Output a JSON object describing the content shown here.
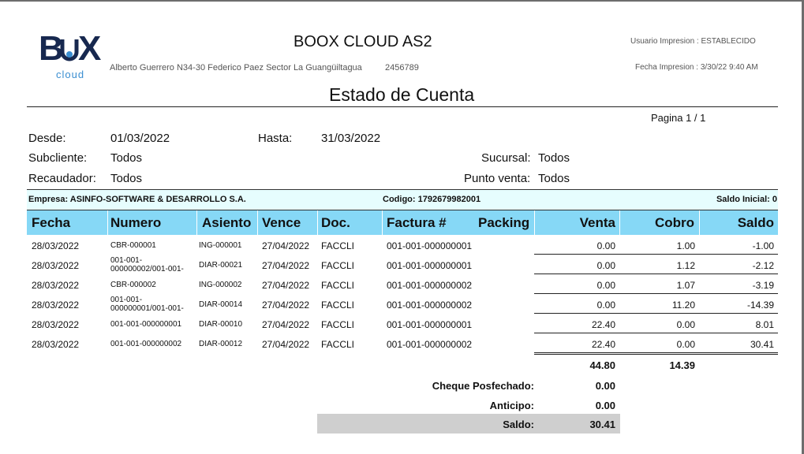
{
  "header": {
    "logo_text": "B  X",
    "logo_sub": "cloud",
    "company": "BOOX CLOUD AS2",
    "address": "Alberto Guerrero N34-30 Federico Paez Sector La Guangüiltagua",
    "phone": "2456789",
    "user_print": "Usuario Impresion : ESTABLECIDO",
    "date_print": "Fecha Impresion : 3/30/22 9:40 AM",
    "title": "Estado de Cuenta",
    "page": "Pagina 1 / 1"
  },
  "filters": {
    "desde_label": "Desde:",
    "desde_value": "01/03/2022",
    "hasta_label": "Hasta:",
    "hasta_value": "31/03/2022",
    "subcliente_label": "Subcliente:",
    "subcliente_value": "Todos",
    "sucursal_label": "Sucursal:",
    "sucursal_value": "Todos",
    "recaudador_label": "Recaudador:",
    "recaudador_value": "Todos",
    "punto_label": "Punto venta:",
    "punto_value": "Todos"
  },
  "info": {
    "empresa": "Empresa:  ASINFO-SOFTWARE & DESARROLLO S.A.",
    "codigo": "Codigo:  1792679982001",
    "saldo_inicial": "Saldo Inicial:  0"
  },
  "columns": [
    "Fecha",
    "Numero",
    "Asiento",
    "Vence",
    "Doc.",
    "Factura #",
    "Packing",
    "Venta",
    "Cobro",
    "Saldo"
  ],
  "rows": [
    {
      "fecha": "28/03/2022",
      "numero": "CBR-000001",
      "asiento": "ING-000001",
      "vence": "27/04/2022",
      "doc": "FACCLI",
      "factura": "001-001-000000001",
      "packing": "",
      "venta": "0.00",
      "cobro": "1.00",
      "saldo": "-1.00"
    },
    {
      "fecha": "28/03/2022",
      "numero": "001-001-\n000000002/001-001-",
      "asiento": "DIAR-00021",
      "vence": "27/04/2022",
      "doc": "FACCLI",
      "factura": "001-001-000000001",
      "packing": "",
      "venta": "0.00",
      "cobro": "1.12",
      "saldo": "-2.12"
    },
    {
      "fecha": "28/03/2022",
      "numero": "CBR-000002",
      "asiento": "ING-000002",
      "vence": "27/04/2022",
      "doc": "FACCLI",
      "factura": "001-001-000000002",
      "packing": "",
      "venta": "0.00",
      "cobro": "1.07",
      "saldo": "-3.19"
    },
    {
      "fecha": "28/03/2022",
      "numero": "001-001-\n000000001/001-001-",
      "asiento": "DIAR-00014",
      "vence": "27/04/2022",
      "doc": "FACCLI",
      "factura": "001-001-000000002",
      "packing": "",
      "venta": "0.00",
      "cobro": "11.20",
      "saldo": "-14.39"
    },
    {
      "fecha": "28/03/2022",
      "numero": "001-001-000000001",
      "asiento": "DIAR-00010",
      "vence": "27/04/2022",
      "doc": "FACCLI",
      "factura": "001-001-000000001",
      "packing": "",
      "venta": "22.40",
      "cobro": "0.00",
      "saldo": "8.01"
    },
    {
      "fecha": "28/03/2022",
      "numero": "001-001-000000002",
      "asiento": "DIAR-00012",
      "vence": "27/04/2022",
      "doc": "FACCLI",
      "factura": "001-001-000000002",
      "packing": "",
      "venta": "22.40",
      "cobro": "0.00",
      "saldo": "30.41"
    }
  ],
  "totals": {
    "venta": "44.80",
    "cobro": "14.39",
    "cheque_label": "Cheque Posfechado:",
    "cheque_value": "0.00",
    "anticipo_label": "Anticipo:",
    "anticipo_value": "0.00",
    "saldo_label": "Saldo:",
    "saldo_value": "30.41"
  },
  "colors": {
    "header_row": "#86d8f6",
    "info_bar": "#e6fdfe",
    "saldo_bar": "#cfcfcf",
    "logo": "#17284f",
    "logo_accent": "#3a8ed1"
  }
}
